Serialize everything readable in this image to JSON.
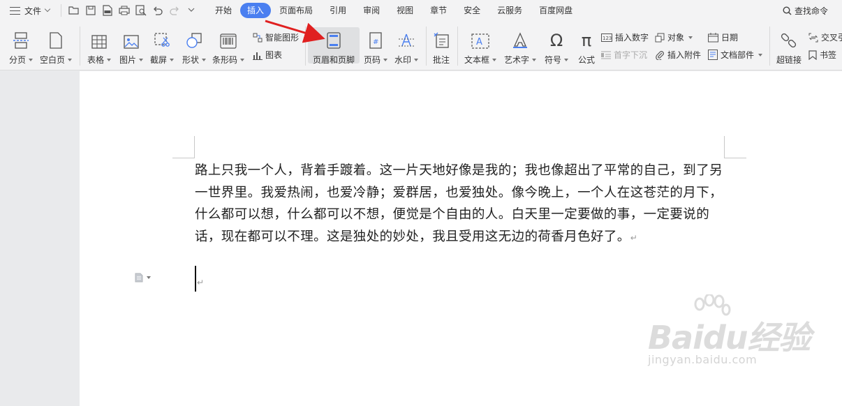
{
  "menu": {
    "file_label": "文件",
    "tabs": [
      {
        "label": "开始",
        "active": false
      },
      {
        "label": "插入",
        "active": true
      },
      {
        "label": "页面布局",
        "active": false
      },
      {
        "label": "引用",
        "active": false
      },
      {
        "label": "审阅",
        "active": false
      },
      {
        "label": "视图",
        "active": false
      },
      {
        "label": "章节",
        "active": false
      },
      {
        "label": "安全",
        "active": false
      },
      {
        "label": "云服务",
        "active": false
      },
      {
        "label": "百度网盘",
        "active": false
      }
    ],
    "search_label": "查找命令"
  },
  "ribbon": {
    "page_break": "分页",
    "blank_page": "空白页",
    "table": "表格",
    "picture": "图片",
    "screenshot": "截屏",
    "shape": "形状",
    "barcode": "条形码",
    "smart_art": "智能图形",
    "chart": "图表",
    "header_footer": "页眉和页脚",
    "page_number": "页码",
    "watermark": "水印",
    "comment": "批注",
    "text_box": "文本框",
    "word_art": "艺术字",
    "symbol": "符号",
    "formula": "公式",
    "insert_number": "插入数字",
    "drop_cap": "首字下沉",
    "object": "对象",
    "insert_attachment": "插入附件",
    "date": "日期",
    "doc_parts": "文档部件",
    "hyperlink": "超链接",
    "cross_ref": "交叉引",
    "bookmark": "书签"
  },
  "document": {
    "paragraph": "路上只我一个人，背着手踱着。这一片天地好像是我的；我也像超出了平常的自己，到了另一世界里。我爱热闹，也爱冷静；爱群居，也爱独处。像今晚上，一个人在这苍茫的月下，什么都可以想，什么都可以不想，便觉是个自由的人。白天里一定要做的事，一定要说的话，现在都可以不理。这是独处的妙处，我且受用这无边的荷香月色好了。",
    "paragraph_mark": "↵"
  },
  "watermark": {
    "brand": "Baidu经验",
    "url": "jingyan.baidu.com"
  },
  "colors": {
    "accent": "#4a7ff0",
    "annotation_arrow": "#e02020"
  }
}
